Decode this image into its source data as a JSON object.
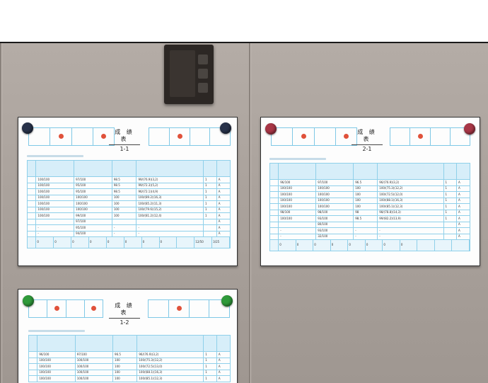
{
  "sheets": [
    {
      "title": "成 绩 表",
      "subtitle": "1-1",
      "rows": [
        [
          "100/100",
          "97/100",
          "98.5",
          "99/(76.9)(3,2)",
          "1",
          "A"
        ],
        [
          "100/100",
          "95/100",
          "98.5",
          "99/(72.3)(5,2)",
          "1",
          "A"
        ],
        [
          "100/100",
          "95/100",
          "98.5",
          "96/(72.1)(4,9)",
          "1",
          "A"
        ],
        [
          "100/100",
          "100/100",
          "100",
          "100/(89.2)(16,3)",
          "1",
          "A"
        ],
        [
          "100/100",
          "100/100",
          "100",
          "100/(85.2)(11,3)",
          "1",
          "A"
        ],
        [
          "100/100",
          "100/100",
          "100",
          "100/(79.6)(15,2)",
          "1",
          "A"
        ],
        [
          "100/100",
          "99/100",
          "100",
          "100/(81.2)(12,4)",
          "1",
          "A"
        ],
        [
          "",
          "97/100",
          "",
          "",
          "",
          "A"
        ],
        [
          "-",
          "95/100",
          "-",
          "-",
          "",
          "A"
        ],
        [
          "-",
          "94/100",
          "-",
          "-",
          "",
          "A"
        ]
      ],
      "footer": [
        "0",
        "0",
        "0",
        "0",
        "0",
        "0",
        "0",
        "0",
        "",
        "12/50",
        "3/25"
      ]
    },
    {
      "title": "成 绩 表",
      "subtitle": "2-1",
      "rows": [
        [
          "96/100",
          "97/100",
          "96.5",
          "96/(76.9)(3,2)",
          "1",
          "A"
        ],
        [
          "100/100",
          "100/100",
          "100",
          "100/(75.3)(12,2)",
          "1",
          "A"
        ],
        [
          "100/100",
          "100/100",
          "100",
          "100/(72.5)(12,0)",
          "1",
          "A"
        ],
        [
          "100/100",
          "100/100",
          "100",
          "100/(88.1)(16,3)",
          "1",
          "A"
        ],
        [
          "100/100",
          "100/100",
          "100",
          "100/(85.1)(12,3)",
          "1",
          "A"
        ],
        [
          "98/100",
          "98/100",
          "98",
          "98/(78.8)(14,3)",
          "1",
          "A"
        ],
        [
          "100/100",
          "93/100",
          "98.5",
          "99/(82.2)(13,9)",
          "1",
          "A"
        ],
        [
          "",
          "80/100",
          "",
          "",
          "",
          "A"
        ],
        [
          "-",
          "93/100",
          "-",
          "-",
          "",
          "A"
        ],
        [
          "-",
          "32/100",
          "-",
          "-",
          "",
          "A"
        ]
      ],
      "footer": [
        "0",
        "0",
        "0",
        "0",
        "0",
        "0",
        "0",
        "0",
        "",
        "",
        ""
      ]
    },
    {
      "title": "成 绩 表",
      "subtitle": "1-2",
      "rows": [
        [
          "96/100",
          "97/100",
          "96.5",
          "96/(76.9)(3,2)",
          "1",
          "A"
        ],
        [
          "100/100",
          "100/100",
          "100",
          "100/(75.3)(12,2)",
          "1",
          "A"
        ],
        [
          "100/100",
          "100/100",
          "100",
          "100/(72.5)(13,0)",
          "1",
          "A"
        ],
        [
          "100/100",
          "100/100",
          "100",
          "100/(88.1)(16,3)",
          "1",
          "A"
        ],
        [
          "100/100",
          "100/100",
          "100",
          "100/(85.1)(12,3)",
          "1",
          "A"
        ]
      ],
      "footer": []
    }
  ]
}
